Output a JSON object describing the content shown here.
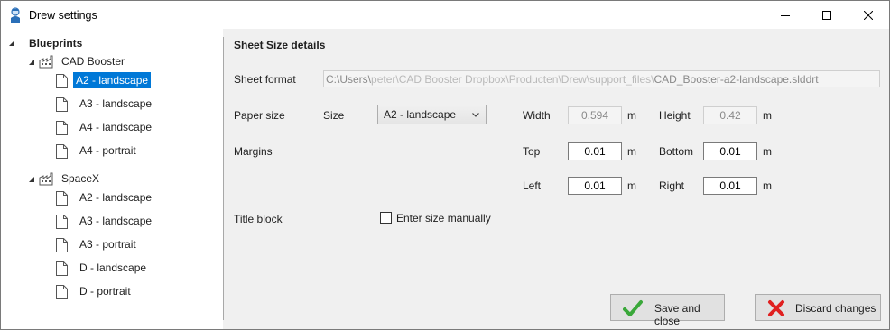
{
  "window": {
    "title": "Drew settings",
    "controls": [
      "minimize-icon",
      "maximize-icon",
      "close-icon"
    ]
  },
  "tree": {
    "root": "Blueprints",
    "groups": [
      {
        "name": "CAD Booster",
        "items": [
          "A2 - landscape",
          "A3 - landscape",
          "A4 - landscape",
          "A4 - portrait"
        ],
        "selected_index": 0
      },
      {
        "name": "SpaceX",
        "items": [
          "A2 - landscape",
          "A3 - landscape",
          "A3 - portrait",
          "D - landscape",
          "D - portrait"
        ]
      }
    ]
  },
  "details": {
    "section_title": "Sheet Size details",
    "sheet_format": {
      "label": "Sheet format",
      "path_prefix": "C:\\Users\\",
      "path_obscured": "peter\\CAD Booster Dropbox\\Producten\\Drew\\support_files\\",
      "path_suffix": "CAD_Booster-a2-landscape.slddrt"
    },
    "paper_size": {
      "label": "Paper size",
      "size_label": "Size",
      "size_value": "A2 - landscape",
      "width_label": "Width",
      "width_value": "0.594",
      "height_label": "Height",
      "height_value": "0.42",
      "unit": "m"
    },
    "margins": {
      "label": "Margins",
      "top_label": "Top",
      "top_value": "0.01",
      "bottom_label": "Bottom",
      "bottom_value": "0.01",
      "left_label": "Left",
      "left_value": "0.01",
      "right_label": "Right",
      "right_value": "0.01",
      "unit": "m"
    },
    "title_block": {
      "label": "Title block",
      "checkbox_label": "Enter size manually",
      "checked": false
    }
  },
  "buttons": {
    "save": "Save and close",
    "discard": "Discard changes"
  },
  "colors": {
    "selection": "#0078d7",
    "save_icon": "#3aa83a",
    "discard_icon": "#e02020"
  }
}
